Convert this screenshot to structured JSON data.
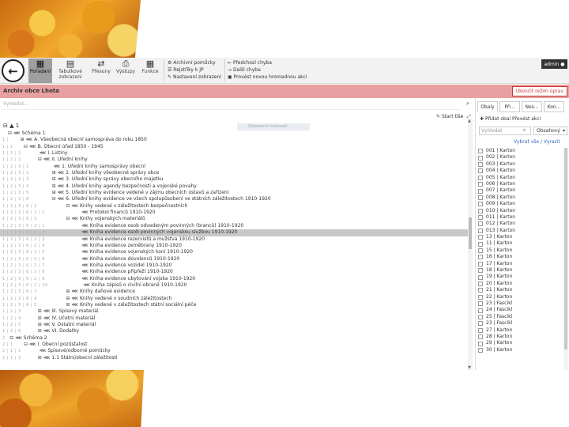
{
  "toolbar": {
    "buttons": [
      {
        "label": "Pořadaní",
        "icon": "tree-icon"
      },
      {
        "label": "Tabulkové zobrazení",
        "icon": "table-icon"
      },
      {
        "label": "Přesuny",
        "icon": "swap-icon"
      },
      {
        "label": "Výstupy",
        "icon": "print-icon"
      },
      {
        "label": "Funkce",
        "icon": "calculator-icon"
      }
    ],
    "group1": [
      "Archivní pomůcky",
      "Rejstříky k JP",
      "Nastavení zobrazení"
    ],
    "group2": [
      "Předchozí chyba",
      "Další chyba",
      "Provést novou hromadnou akci"
    ],
    "admin": "admin"
  },
  "titlebar": {
    "title": "Archiv obce Lhota",
    "button": "Ukončit režim úprav"
  },
  "left": {
    "search_placeholder": "Vyhledat...",
    "start_search": "Start tiše",
    "tree_root": "1",
    "tooltip": "Zobrazení možností",
    "rows": [
      {
        "g": "",
        "d": 0,
        "t": "⊟",
        "text": "Schéma 1"
      },
      {
        "g": "1 |",
        "d": 1,
        "t": "⊞",
        "text": "A. Všeobecná obecní samospráva do roku 1850"
      },
      {
        "g": "1 | 1",
        "d": 1,
        "t": "⊟",
        "text": "B. Obecní úřad 1850 - 1945"
      },
      {
        "g": "1 | 2 | 1",
        "d": 2,
        "t": "",
        "text": "I. Listiny"
      },
      {
        "g": "1 | 2 | 2",
        "d": 2,
        "t": "⊟",
        "text": "II. Úřední knihy"
      },
      {
        "g": "1 | 2 | 3 | 1",
        "d": 3,
        "t": "",
        "text": "1. Úřední knihy samosprávy obecní"
      },
      {
        "g": "1 | 2 | 3 | 2",
        "d": 3,
        "t": "⊞",
        "text": "2. Úřední knihy všeobecné správy obce"
      },
      {
        "g": "1 | 2 | 3 | 3",
        "d": 3,
        "t": "⊞",
        "text": "3. Úřední knihy správy obecního majetku"
      },
      {
        "g": "1 | 2 | 3 | 4",
        "d": 3,
        "t": "⊞",
        "text": "4. Úřední knihy agendy bezpečnosti a vojenské povahy"
      },
      {
        "g": "1 | 2 | 3 | 5",
        "d": 3,
        "t": "⊞",
        "text": "5. Úřední knihy evidence vedené v zájmu obecních ústavů a zařízení"
      },
      {
        "g": "1 | 2 | 3 | 6",
        "d": 3,
        "t": "⊟",
        "text": "6. Úřední knihy evidence ve všech spolupůsobení ve státních záležitostech 1910-1920"
      },
      {
        "g": "1 | 2 | 3 | 6 | 1",
        "d": 4,
        "t": "⊟",
        "text": "Knihy vedené v záležitostech bezpečnostních"
      },
      {
        "g": "1 | 2 | 3 | 6 | 1 | 1",
        "d": 5,
        "t": "",
        "text": "Protokol financů 1910-1920"
      },
      {
        "g": "1 | 2 | 3 | 6 | 2",
        "d": 4,
        "t": "⊟",
        "text": "Knihy vojenských materiálů"
      },
      {
        "g": "1 | 2 | 3 | 6 | 2 | 1",
        "d": 5,
        "t": "",
        "text": "Kniha evidence osob odvedeným povinných (branců) 1910-1920"
      },
      {
        "g": "1 | 2 | 3 | 6 | 2 | 2",
        "d": 5,
        "t": "",
        "text": "Kniha evidence osob povinných vojenskou službou 1910-1920",
        "sel": true
      },
      {
        "g": "1 | 2 | 3 | 6 | 2 | 3",
        "d": 5,
        "t": "",
        "text": "Kniha evidence rezervistů a mužstva 1910-1920"
      },
      {
        "g": "1 | 2 | 3 | 6 | 2 | 4",
        "d": 5,
        "t": "",
        "text": "Kniha evidence zeměbrany 1910-1920"
      },
      {
        "g": "1 | 2 | 3 | 6 | 2 | 5",
        "d": 5,
        "t": "",
        "text": "Kniha evidence vojenských koní 1910-1920"
      },
      {
        "g": "1 | 2 | 3 | 6 | 2 | 6",
        "d": 5,
        "t": "",
        "text": "Kniha evidence dovolenců 1910-1920"
      },
      {
        "g": "1 | 2 | 3 | 6 | 2 | 7",
        "d": 5,
        "t": "",
        "text": "Kniha evidence vozidel 1910-1920"
      },
      {
        "g": "1 | 2 | 3 | 6 | 2 | 8",
        "d": 5,
        "t": "",
        "text": "Kniha evidence přípřeží 1910-1920"
      },
      {
        "g": "1 | 2 | 3 | 6 | 2 | 9",
        "d": 5,
        "t": "",
        "text": "Kniha evidence ubytování vojska 1910-1920"
      },
      {
        "g": "1 | 2 | 3 | 6 | 2 | 10",
        "d": 5,
        "t": "",
        "text": "Kniha zápisů o civilní obraně 1910-1920"
      },
      {
        "g": "1 | 2 | 3 | 6 | 3",
        "d": 4,
        "t": "⊞",
        "text": "Knihy daňové evidence"
      },
      {
        "g": "1 | 2 | 3 | 6 | 4",
        "d": 4,
        "t": "⊞",
        "text": "Knihy vedené v soudních záležitostech"
      },
      {
        "g": "1 | 2 | 3 | 6 | 5",
        "d": 4,
        "t": "⊞",
        "text": "Knihy vedené v záležitostech státní sociální péče"
      },
      {
        "g": "1 | 2 | 3",
        "d": 2,
        "t": "⊞",
        "text": "III. Spisový materiál"
      },
      {
        "g": "1 | 2 | 4",
        "d": 2,
        "t": "⊞",
        "text": "IV. Účetní materiál"
      },
      {
        "g": "1 | 2 | 5",
        "d": 2,
        "t": "⊞",
        "text": "V. Ostatní materiál"
      },
      {
        "g": "1 | 2 | 6",
        "d": 2,
        "t": "⊞",
        "text": "VI. Dodatky"
      },
      {
        "g": "2",
        "d": 0,
        "t": "⊟",
        "text": "Schéma 2"
      },
      {
        "g": "2 | 1",
        "d": 1,
        "t": "⊟",
        "text": "I. Obecní pozůstalost"
      },
      {
        "g": "2 | 1 | 1",
        "d": 2,
        "t": "",
        "text": "Spisové/odborné pomůcky"
      },
      {
        "g": "2 | 1 | 2",
        "d": 2,
        "t": "⊞",
        "text": "1.1 Státní/obecní záležitosti"
      }
    ]
  },
  "right": {
    "tabs": [
      "Obaly",
      "Při...",
      "Nes...",
      "Kon..."
    ],
    "links": "Přidat obal  Převést akci",
    "search_placeholder": "Vyhledat",
    "select_value": "Obsahový",
    "select_all": "Vybrat vše / Vyrazit",
    "items": [
      "001 | Karton",
      "002 | Karton",
      "003 | Karton",
      "004 | Karton",
      "005 | Karton",
      "006 | Karton",
      "007 | Karton",
      "008 | Karton",
      "009 | Karton",
      "010 | Karton",
      "011 | Karton",
      "012 | Karton",
      "013 | Karton",
      "13 | Karton",
      "11 | Karton",
      "15 | Karton",
      "16 | Karton",
      "17 | Karton",
      "18 | Karton",
      "19 | Karton",
      "20 | Karton",
      "21 | Karton",
      "22 | Karton",
      "23 | Fascikl",
      "24 | Fascikl",
      "25 | Fascikl",
      "23 | Fascikl",
      "27 | Karton",
      "28 | Karton",
      "29 | Karton",
      "30 | Karton"
    ]
  }
}
